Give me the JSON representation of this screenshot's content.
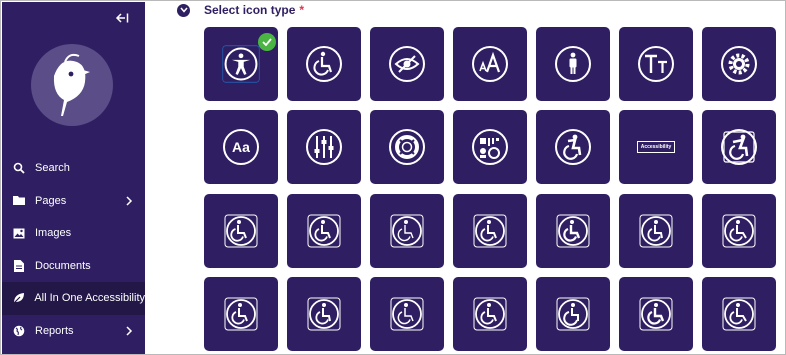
{
  "sidebar": {
    "items": [
      {
        "label": "Search",
        "icon": "search-icon",
        "has_chevron": false
      },
      {
        "label": "Pages",
        "icon": "folder-icon",
        "has_chevron": true
      },
      {
        "label": "Images",
        "icon": "image-icon",
        "has_chevron": false
      },
      {
        "label": "Documents",
        "icon": "document-icon",
        "has_chevron": false
      },
      {
        "label": "All In One Accessibility",
        "icon": "leaf-icon",
        "has_chevron": false,
        "active": true
      },
      {
        "label": "Reports",
        "icon": "globe-icon",
        "has_chevron": true
      }
    ]
  },
  "main": {
    "section_title": "Select icon type",
    "required_marker": "*",
    "accessibility_label": "Accessibility",
    "selected_icon": "accessibility-person-icon",
    "icons": [
      "accessibility-person-icon",
      "wheelchair-circle-icon",
      "eye-slash-icon",
      "text-size-icon",
      "person-standing-icon",
      "text-height-icon",
      "gear-icon",
      "font-aa-icon",
      "sliders-icon",
      "lifebuoy-icon",
      "accessibility-settings-icon",
      "wheelchair-active-icon",
      "accessibility-text-icon",
      "wheelchair-dynamic-icon",
      "wheelchair-icon",
      "wheelchair-icon",
      "wheelchair-icon",
      "wheelchair-icon",
      "wheelchair-icon",
      "wheelchair-icon",
      "wheelchair-icon",
      "wheelchair-icon",
      "wheelchair-icon",
      "wheelchair-icon",
      "wheelchair-icon",
      "wheelchair-icon",
      "wheelchair-icon",
      "wheelchair-icon"
    ]
  },
  "colors": {
    "sidebar_bg": "#2f1f62",
    "tile_bg": "#2f1f62",
    "active_item_bg": "#231747",
    "required": "#e5334b",
    "check": "#4bb543"
  }
}
